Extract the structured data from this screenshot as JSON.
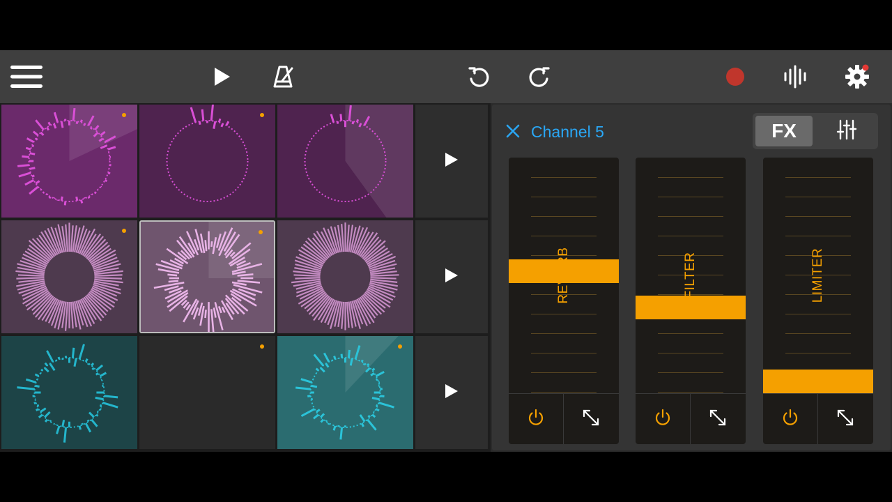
{
  "toolbar": {
    "icons": [
      "menu-icon",
      "play-icon",
      "metronome-icon",
      "undo-icon",
      "redo-icon",
      "record-icon",
      "waveform-icon",
      "settings-icon"
    ],
    "record_color": "#c0362c",
    "notification_color": "#e53935"
  },
  "pads": [
    {
      "row": 0,
      "col": 0,
      "color": "#6b2a6b",
      "accent": "#d94fd6",
      "style": "playing-ring",
      "progress": 0.18,
      "indicator": true
    },
    {
      "row": 0,
      "col": 1,
      "color": "#4f234f",
      "accent": "#d94fd6",
      "style": "dotted-ring",
      "indicator": true
    },
    {
      "row": 0,
      "col": 2,
      "color": "#4f234f",
      "accent": "#d94fd6",
      "style": "dotted-ring",
      "progress": 0.4,
      "indicator": false
    },
    {
      "row": 1,
      "col": 0,
      "color": "#4e3a4e",
      "accent": "#c48bc2",
      "style": "dense-burst",
      "indicator": true
    },
    {
      "row": 1,
      "col": 1,
      "color": "#6f556e",
      "accent": "#e8b3e6",
      "style": "spiky-burst",
      "progress": 0.25,
      "indicator": true,
      "selected": true
    },
    {
      "row": 1,
      "col": 2,
      "color": "#4e3a4e",
      "accent": "#c48bc2",
      "style": "dense-burst",
      "indicator": false
    },
    {
      "row": 2,
      "col": 0,
      "color": "#1d4447",
      "accent": "#24b6cc",
      "style": "dotted-burst",
      "indicator": false
    },
    {
      "row": 2,
      "col": 1,
      "color": "#2a2a2a",
      "accent": "#2a2a2a",
      "style": "empty",
      "indicator": true
    },
    {
      "row": 2,
      "col": 2,
      "color": "#2b6c70",
      "accent": "#2bc3d8",
      "style": "dotted-burst",
      "progress": 0.12,
      "indicator": true
    }
  ],
  "scene_buttons": [
    "scene-play-1",
    "scene-play-2",
    "scene-play-3"
  ],
  "fx_panel": {
    "title": "Channel 5",
    "tab_fx": "FX",
    "accent": "#f5a000",
    "title_color": "#2aa7f5",
    "effects": [
      {
        "label": "REVERB",
        "level": 0.52
      },
      {
        "label": "FILTER",
        "level": 0.35
      },
      {
        "label": "LIMITER",
        "level": 0.0
      }
    ]
  }
}
